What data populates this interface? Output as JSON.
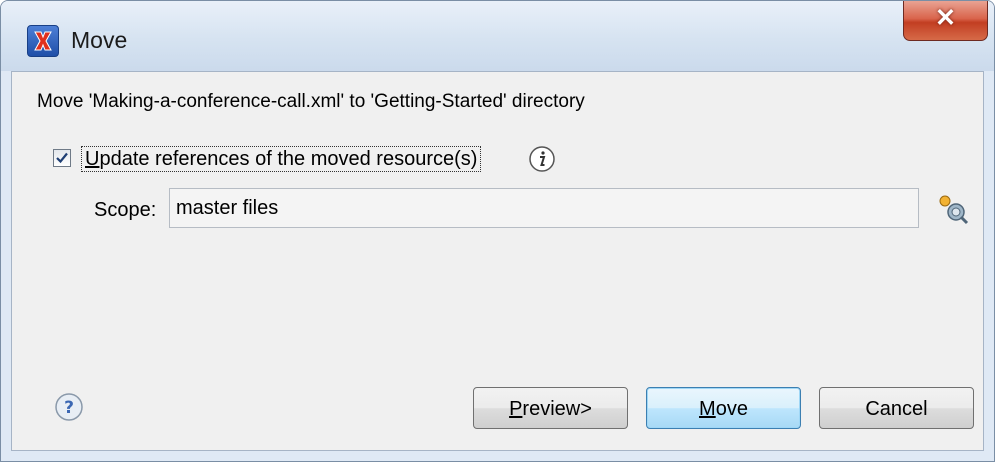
{
  "window": {
    "title": "Move",
    "app_icon": "oxygen-x-icon",
    "close_icon": "close-icon"
  },
  "dialog": {
    "message": "Move 'Making-a-conference-call.xml' to 'Getting-Started' directory",
    "update_refs": {
      "checked": true,
      "mnemonic": "U",
      "label_rest": "pdate references of the moved resource(s)"
    },
    "scope": {
      "label": "Scope:",
      "value": "master files"
    }
  },
  "buttons": {
    "preview": {
      "mnemonic": "P",
      "label_rest": "review>"
    },
    "move": {
      "mnemonic": "M",
      "label_rest": "ove"
    },
    "cancel": {
      "label": "Cancel"
    }
  },
  "colors": {
    "accent": "#3c7fb1",
    "close": "#c23e22",
    "titlebar": "#d6e3f1"
  }
}
